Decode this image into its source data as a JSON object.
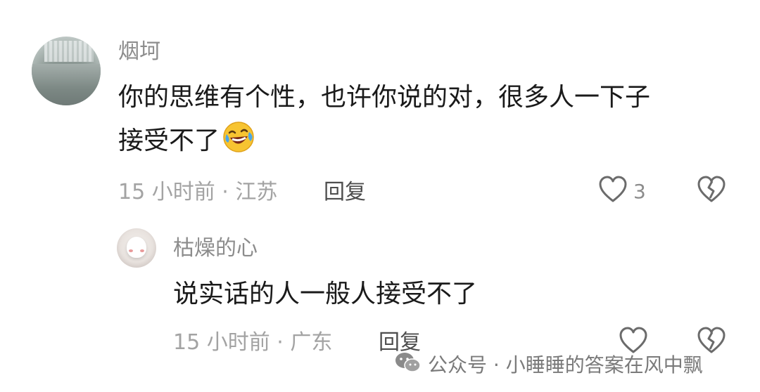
{
  "comment": {
    "username": "烟坷",
    "text_line1": "你的思维有个性，也许你说的对，很多人一下子",
    "text_line2": "接受不了",
    "emoji_icon": "laughing-crying-face-icon",
    "meta": "15 小时前 · 江苏",
    "reply_label": "回复",
    "like_count": "3"
  },
  "reply": {
    "username": "枯燥的心",
    "text": "说实话的人一般人接受不了",
    "meta": "15 小时前 · 广东",
    "reply_label": "回复"
  },
  "watermark": {
    "text": "公众号 · 小睡睡的答案在风中飘"
  },
  "colors": {
    "username": "#8c8c8c",
    "content": "#1a1a1a",
    "meta": "#a3a3a3",
    "icon": "#6b6b6b"
  }
}
